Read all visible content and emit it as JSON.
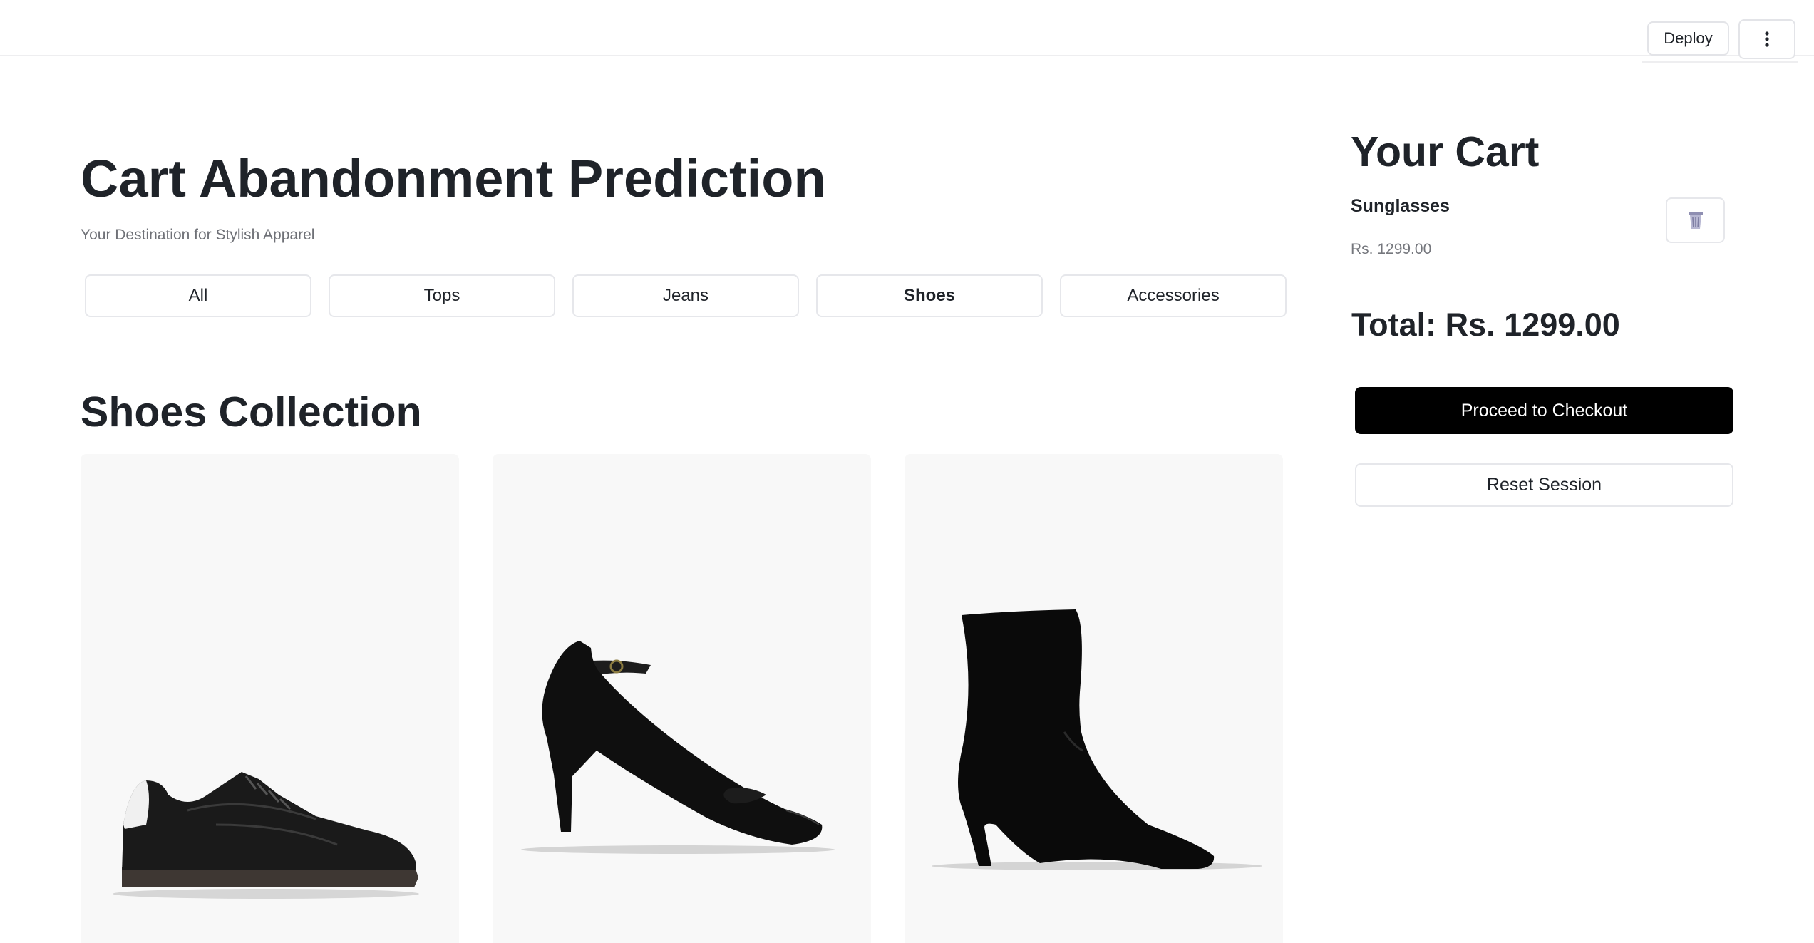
{
  "toolbar": {
    "deploy_label": "Deploy",
    "menu_icon": "vertical-ellipsis-icon"
  },
  "header": {
    "title": "Cart Abandonment Prediction",
    "subtitle": "Your Destination for Stylish Apparel"
  },
  "categories": [
    {
      "label": "All",
      "active": false
    },
    {
      "label": "Tops",
      "active": false
    },
    {
      "label": "Jeans",
      "active": false
    },
    {
      "label": "Shoes",
      "active": true
    },
    {
      "label": "Accessories",
      "active": false
    }
  ],
  "collection": {
    "title": "Shoes Collection",
    "products": [
      {
        "image": "black-sneaker-image"
      },
      {
        "image": "black-patent-heel-image"
      },
      {
        "image": "black-suede-ankle-boot-image"
      }
    ]
  },
  "cart": {
    "title": "Your Cart",
    "items": [
      {
        "name": "Sunglasses",
        "price": "Rs. 1299.00",
        "remove_icon": "trash-icon"
      }
    ],
    "total": "Total: Rs. 1299.00",
    "checkout_label": "Proceed to Checkout",
    "reset_label": "Reset Session"
  },
  "colors": {
    "background": "#ffffff",
    "text": "#1f2329",
    "muted_text": "#6f7177",
    "border": "#e6e7eb",
    "checkout_bg": "#000000",
    "card_bg": "#f8f8f8"
  }
}
